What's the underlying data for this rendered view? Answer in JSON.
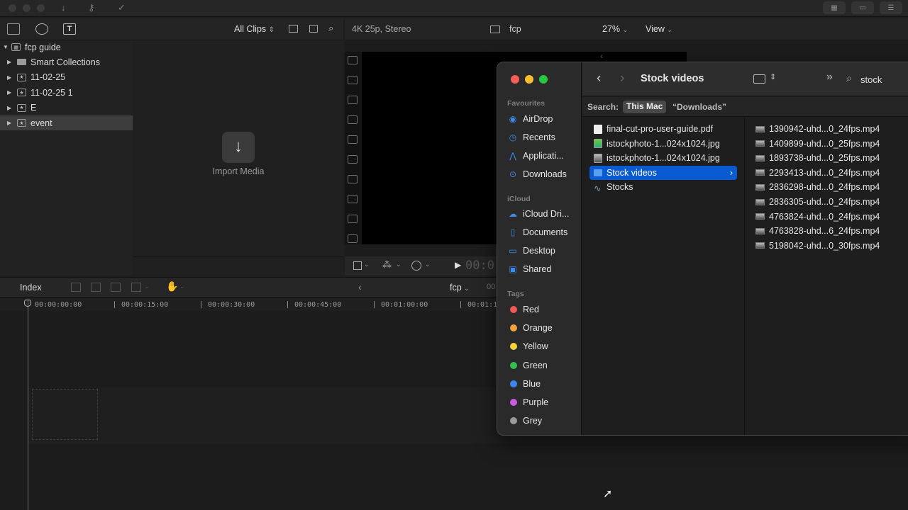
{
  "browser": {
    "clips_filter": "All Clips",
    "library": "fcp guide",
    "items": [
      {
        "label": "Smart Collections",
        "type": "folder"
      },
      {
        "label": "11-02-25",
        "type": "event"
      },
      {
        "label": "11-02-25 1",
        "type": "event"
      },
      {
        "label": "E",
        "type": "event"
      },
      {
        "label": "event",
        "type": "event",
        "selected": true
      }
    ],
    "import_label": "Import Media"
  },
  "viewer": {
    "format": "4K 25p, Stereo",
    "project": "fcp",
    "zoom": "27%",
    "view_label": "View",
    "timecode_fragment": "00:0"
  },
  "timeline": {
    "index_label": "Index",
    "project": "fcp",
    "timecodes": [
      "00:00:00:00",
      "00:00:15:00",
      "00:00:30:00",
      "00:00:45:00",
      "00:01:00:00",
      "00:01:1"
    ],
    "header_tc": "00"
  },
  "finder": {
    "title": "Stock videos",
    "search_value": "stock",
    "search_label": "Search:",
    "scope_this_mac": "This Mac",
    "scope_downloads": "“Downloads”",
    "favourites_label": "Favourites",
    "favourites": [
      "AirDrop",
      "Recents",
      "Applicati...",
      "Downloads"
    ],
    "icloud_label": "iCloud",
    "icloud": [
      "iCloud Dri...",
      "Documents",
      "Desktop",
      "Shared"
    ],
    "tags_label": "Tags",
    "tags": [
      {
        "name": "Red",
        "color": "#ec5b52"
      },
      {
        "name": "Orange",
        "color": "#f2a13b"
      },
      {
        "name": "Yellow",
        "color": "#f4d23a"
      },
      {
        "name": "Green",
        "color": "#37c049"
      },
      {
        "name": "Blue",
        "color": "#3a86f0"
      },
      {
        "name": "Purple",
        "color": "#c75ce0"
      },
      {
        "name": "Grey",
        "color": "#9a9a9a"
      }
    ],
    "column1": [
      {
        "name": "final-cut-pro-user-guide.pdf",
        "kind": "pdf"
      },
      {
        "name": "istockphoto-1...024x1024.jpg",
        "kind": "image-green"
      },
      {
        "name": "istockphoto-1...024x1024.jpg",
        "kind": "image-gray"
      },
      {
        "name": "Stock videos",
        "kind": "folder",
        "selected": true
      },
      {
        "name": "Stocks",
        "kind": "chart"
      }
    ],
    "column2": [
      "1390942-uhd...0_24fps.mp4",
      "1409899-uhd...0_25fps.mp4",
      "1893738-uhd...0_25fps.mp4",
      "2293413-uhd...0_24fps.mp4",
      "2836298-uhd...0_24fps.mp4",
      "2836305-uhd...0_24fps.mp4",
      "4763824-uhd...0_24fps.mp4",
      "4763828-uhd...6_24fps.mp4",
      "5198042-uhd...0_30fps.mp4"
    ]
  }
}
